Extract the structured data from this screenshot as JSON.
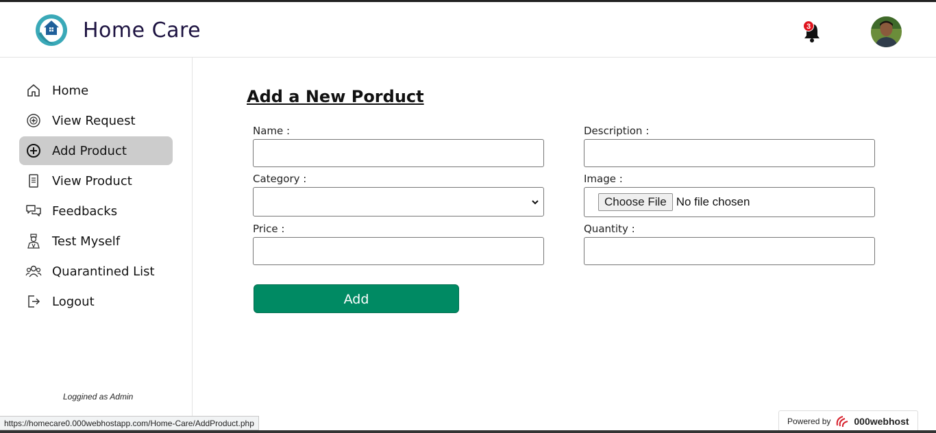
{
  "app": {
    "title": "Home Care"
  },
  "header": {
    "notification_count": "3",
    "bell_icon": "bell-icon",
    "avatar_icon": "user-avatar"
  },
  "sidebar": {
    "items": [
      {
        "label": "Home",
        "icon": "home-icon",
        "active": false
      },
      {
        "label": "View Request",
        "icon": "request-icon",
        "active": false
      },
      {
        "label": "Add Product",
        "icon": "plus-circle-icon",
        "active": true
      },
      {
        "label": "View Product",
        "icon": "document-icon",
        "active": false
      },
      {
        "label": "Feedbacks",
        "icon": "chat-icon",
        "active": false
      },
      {
        "label": "Test Myself",
        "icon": "doctor-icon",
        "active": false
      },
      {
        "label": "Quarantined List",
        "icon": "users-icon",
        "active": false
      },
      {
        "label": "Logout",
        "icon": "logout-icon",
        "active": false
      }
    ],
    "footer": "Loggined as Admin"
  },
  "form": {
    "title": "Add a New Porduct",
    "name_label": "Name :",
    "name_value": "",
    "description_label": "Description :",
    "description_value": "",
    "category_label": "Category :",
    "category_value": "",
    "image_label": "Image :",
    "choose_file": "Choose File",
    "no_file": "No file chosen",
    "price_label": "Price :",
    "price_value": "",
    "quantity_label": "Quantity :",
    "quantity_value": "",
    "submit": "Add"
  },
  "status_bar": {
    "url": "https://homecare0.000webhostapp.com/Home-Care/AddProduct.php"
  },
  "badge": {
    "powered_by": "Powered by",
    "host": "000webhost"
  },
  "colors": {
    "accent": "#008a63",
    "brand_text": "#1c1240",
    "active_nav": "#cccccc",
    "badge_red": "#e0141e"
  }
}
